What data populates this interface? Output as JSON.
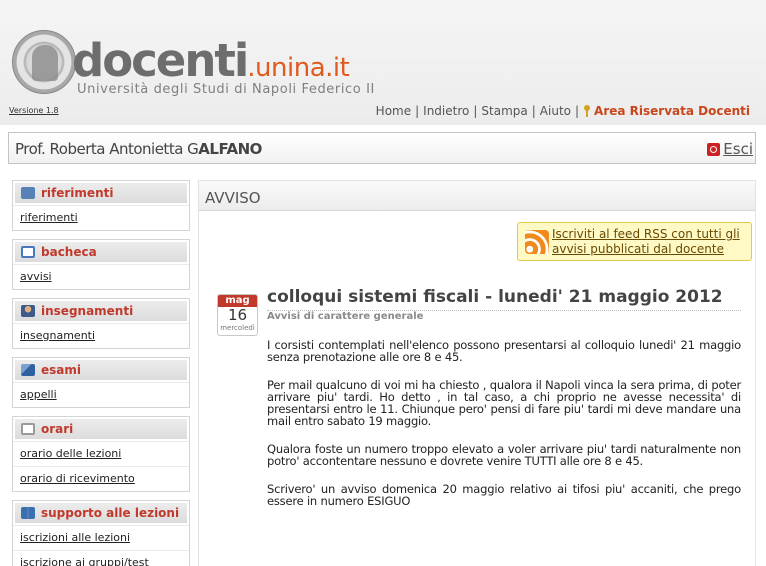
{
  "header": {
    "brand_main": "docenti",
    "brand_domain": ".unina.it",
    "subtitle": "Università degli Studi di Napoli Federico II",
    "version": "Versione 1.8",
    "nav": {
      "home": "Home",
      "back": "Indietro",
      "print": "Stampa",
      "help": "Aiuto",
      "reserved": "Area Riservata Docenti"
    }
  },
  "user": {
    "name_prefix": "Prof. Roberta Antonietta G",
    "name_surname": "ALFANO",
    "logout": "Esci"
  },
  "sidebar": {
    "sections": [
      {
        "title": "riferimenti",
        "icon": "id-card-icon",
        "items": [
          "riferimenti"
        ]
      },
      {
        "title": "bacheca",
        "icon": "window-icon",
        "items": [
          "avvisi"
        ]
      },
      {
        "title": "insegnamenti",
        "icon": "user-icon",
        "items": [
          "insegnamenti"
        ]
      },
      {
        "title": "esami",
        "icon": "exam-icon",
        "items": [
          "appelli"
        ]
      },
      {
        "title": "orari",
        "icon": "clock-icon",
        "items": [
          "orario delle lezioni",
          "orario di ricevimento"
        ]
      },
      {
        "title": "supporto alle lezioni",
        "icon": "book-icon",
        "items": [
          "iscrizioni alle lezioni",
          "iscrizione ai gruppi/test"
        ]
      }
    ]
  },
  "main": {
    "title": "AVVISO",
    "rss_text": "Iscriviti al feed RSS con tutti gli avvisi pubblicati dal docente",
    "date": {
      "month": "mag",
      "day": "16",
      "weekday": "mercoledì"
    },
    "news_title": "colloqui sistemi fiscali - lunedi' 21 maggio 2012",
    "category": "Avvisi di carattere generale",
    "paragraphs": [
      "I corsisti contemplati nell'elenco possono presentarsi al colloquio lunedi' 21 maggio senza prenotazione alle ore 8 e 45.",
      "Per mail qualcuno di voi mi ha chiesto , qualora il Napoli vinca la sera prima, di poter arrivare piu' tardi. Ho detto , in tal caso, a chi proprio ne avesse necessita' di presentarsi entro le 11. Chiunque pero' pensi di fare piu' tardi mi deve mandare una mail entro sabato 19 maggio.",
      "Qualora foste un numero troppo elevato a voler arrivare  piu' tardi naturalmente non potro' accontentare nessuno e dovrete venire TUTTI alle ore 8 e 45.",
      "Scrivero' un  avviso domenica 20 maggio relativo ai tifosi piu' accaniti, che prego essere in numero ESIGUO"
    ]
  }
}
